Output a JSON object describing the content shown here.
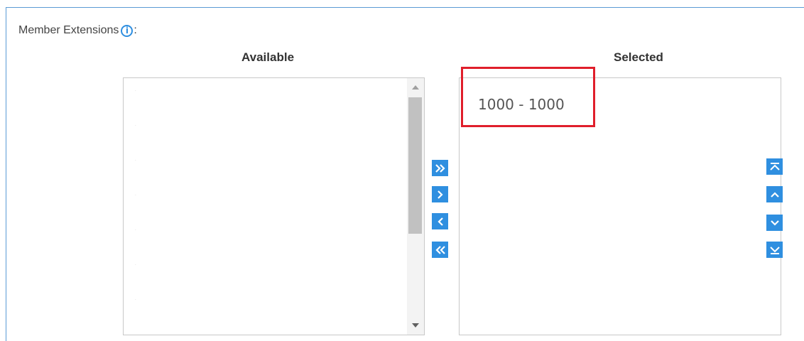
{
  "section": {
    "label": "Member Extensions",
    "info_icon": "info-icon",
    "colon": ":"
  },
  "available": {
    "header": "Available",
    "items": [
      ".",
      ".",
      ".",
      ".",
      ".",
      ".",
      "."
    ]
  },
  "selected": {
    "header": "Selected",
    "items": [
      "1000 - 1000"
    ]
  },
  "transfer_buttons": [
    {
      "name": "add-all-button",
      "icon": "double-chevron-right-icon"
    },
    {
      "name": "add-button",
      "icon": "chevron-right-icon"
    },
    {
      "name": "remove-button",
      "icon": "chevron-left-icon"
    },
    {
      "name": "remove-all-button",
      "icon": "double-chevron-left-icon"
    }
  ],
  "order_buttons": [
    {
      "name": "move-top-button",
      "icon": "move-to-top-icon"
    },
    {
      "name": "move-up-button",
      "icon": "chevron-up-icon"
    },
    {
      "name": "move-down-button",
      "icon": "chevron-down-icon"
    },
    {
      "name": "move-bottom-button",
      "icon": "move-to-bottom-icon"
    }
  ],
  "colors": {
    "accent": "#2f8fe0",
    "highlight": "#e01e2b",
    "panel_border": "#5b9bd5"
  }
}
